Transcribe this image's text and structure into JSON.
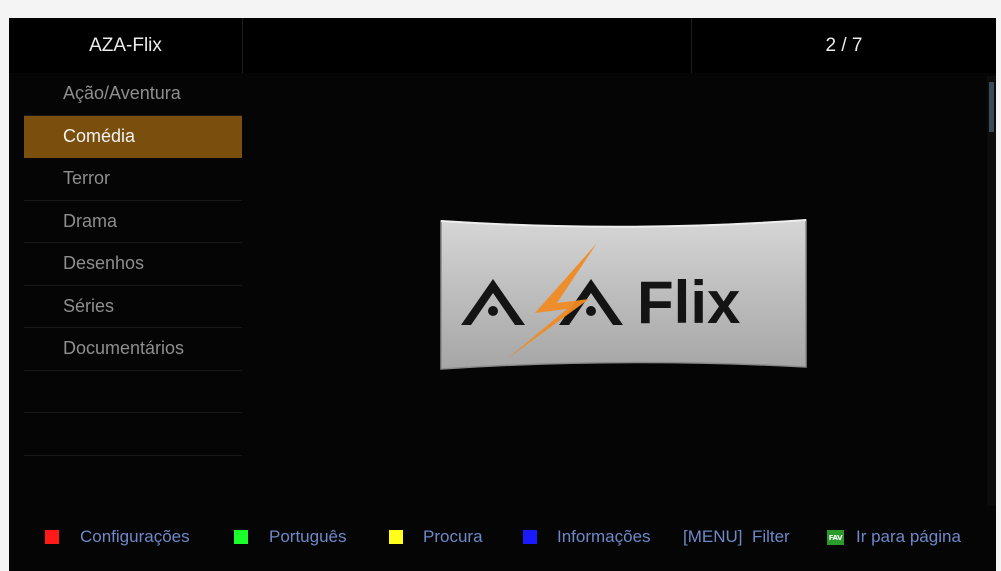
{
  "header": {
    "title": "AZA-Flix",
    "page_indicator": "2 / 7"
  },
  "sidebar": {
    "items": [
      {
        "label": "Ação/Aventura",
        "selected": false
      },
      {
        "label": "Comédia",
        "selected": true
      },
      {
        "label": "Terror",
        "selected": false
      },
      {
        "label": "Drama",
        "selected": false
      },
      {
        "label": "Desenhos",
        "selected": false
      },
      {
        "label": "Séries",
        "selected": false
      },
      {
        "label": "Documentários",
        "selected": false
      }
    ]
  },
  "logo": {
    "text": "Flix",
    "icon": "aza-lightning-logo",
    "accent_color": "#f08a24",
    "panel_color": "#b8b8b8"
  },
  "footer": {
    "red_label": "Configurações",
    "green_label": "Português",
    "yellow_label": "Procura",
    "blue_label": "Informações",
    "menu_label": "[MENU]  Filter",
    "fav_icon_text": "FAV",
    "fav_label": "Ir para página",
    "colors": {
      "red": "#ff1a1a",
      "green": "#1aff2a",
      "yellow": "#ffff1a",
      "blue": "#1a1aff",
      "label": "#6f88c8"
    }
  },
  "colors": {
    "selected_bg": "#7a4e0c",
    "background": "#050505"
  }
}
